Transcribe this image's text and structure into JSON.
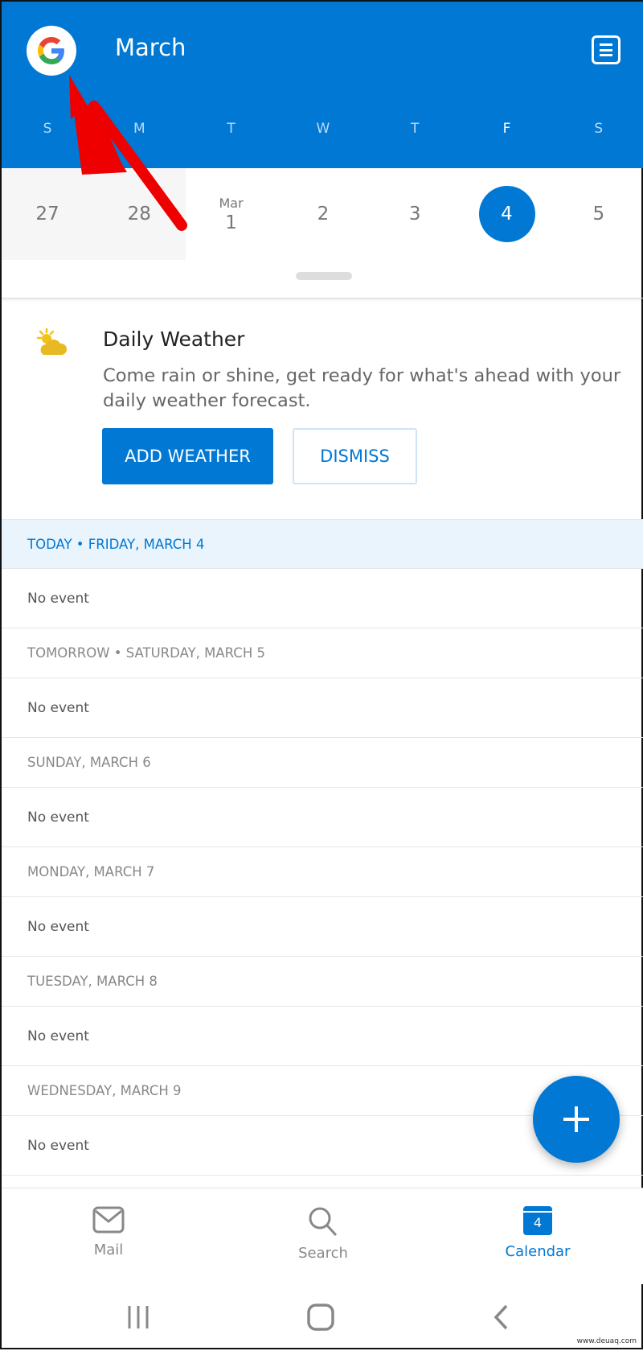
{
  "header": {
    "month": "March",
    "account_icon": "google-g-icon",
    "menu_icon": "menu-list-icon"
  },
  "weekdays": [
    "S",
    "M",
    "T",
    "W",
    "T",
    "F",
    "S"
  ],
  "dates": [
    {
      "day": "27"
    },
    {
      "day": "28"
    },
    {
      "day": "1",
      "month": "Mar"
    },
    {
      "day": "2"
    },
    {
      "day": "3"
    },
    {
      "day": "4",
      "selected": true
    },
    {
      "day": "5"
    }
  ],
  "weather": {
    "title": "Daily Weather",
    "description": "Come rain or shine, get ready for what's ahead with your daily weather forecast.",
    "add_label": "ADD WEATHER",
    "dismiss_label": "DISMISS",
    "icon": "partly-sunny-icon"
  },
  "agenda": [
    {
      "header": "TODAY • FRIDAY, MARCH 4",
      "event": "No event",
      "today": true
    },
    {
      "header": "TOMORROW • SATURDAY, MARCH 5",
      "event": "No event"
    },
    {
      "header": "SUNDAY, MARCH 6",
      "event": "No event"
    },
    {
      "header": "MONDAY, MARCH 7",
      "event": "No event"
    },
    {
      "header": "TUESDAY, MARCH 8",
      "event": "No event"
    },
    {
      "header": "WEDNESDAY, MARCH 9",
      "event": "No event"
    }
  ],
  "bottom_nav": [
    {
      "label": "Mail",
      "icon": "mail-icon"
    },
    {
      "label": "Search",
      "icon": "search-icon"
    },
    {
      "label": "Calendar",
      "icon": "calendar-icon",
      "badge": "4",
      "active": true
    }
  ],
  "colors": {
    "accent": "#0078d4",
    "annotation_arrow": "#ee0000"
  },
  "watermark": "www.deuaq.com"
}
